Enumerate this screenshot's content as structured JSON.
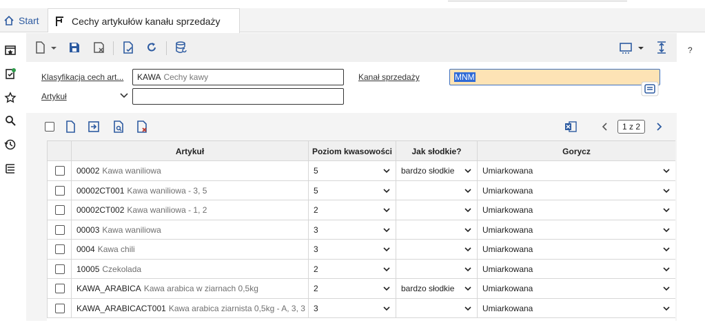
{
  "tabs": {
    "start_label": "Start",
    "active_label": "Cechy artykułów kanału sprzedaży"
  },
  "help_label": "?",
  "filters": {
    "classification_label": "Klasyfikacja cech art...",
    "classification_code": "KAWA",
    "classification_desc": "Cechy kawy",
    "article_label": "Artykuł",
    "article_value": "",
    "channel_label": "Kanał sprzedaży",
    "channel_value": "MNM"
  },
  "pager": {
    "text": "1 z 2"
  },
  "grid": {
    "columns": [
      "Artykuł",
      "Poziom kwasowości",
      "Jak słodkie?",
      "Gorycz"
    ],
    "rows": [
      {
        "code": "00002",
        "desc": "Kawa waniliowa",
        "acidity": "5",
        "sweet": "bardzo słodkie",
        "bitter": "Umiarkowana"
      },
      {
        "code": "00002CT001",
        "desc": "Kawa waniliowa - 3, 5",
        "acidity": "5",
        "sweet": "",
        "bitter": "Umiarkowana"
      },
      {
        "code": "00002CT002",
        "desc": "Kawa waniliowa - 1, 2",
        "acidity": "2",
        "sweet": "",
        "bitter": "Umiarkowana"
      },
      {
        "code": "00003",
        "desc": "Kawa waniliowa",
        "acidity": "3",
        "sweet": "",
        "bitter": "Umiarkowana"
      },
      {
        "code": "0004",
        "desc": "Kawa chili",
        "acidity": "3",
        "sweet": "",
        "bitter": "Umiarkowana"
      },
      {
        "code": "10005",
        "desc": "Czekolada",
        "acidity": "2",
        "sweet": "",
        "bitter": "Umiarkowana"
      },
      {
        "code": "KAWA_ARABICA",
        "desc": "Kawa arabica  w ziarnach 0,5kg",
        "acidity": "2",
        "sweet": "bardzo słodkie",
        "bitter": "Umiarkowana"
      },
      {
        "code": "KAWA_ARABICACT001",
        "desc": "Kawa arabica ziarnista 0,5kg - A, 3, 3",
        "acidity": "3",
        "sweet": "",
        "bitter": "Umiarkowana"
      }
    ]
  },
  "colors": {
    "accent": "#2c5aa0",
    "highlight_field": "#fde3b5",
    "selection": "#2f6ad6",
    "excel_green": "#1e7a45",
    "danger": "#c0392b"
  }
}
